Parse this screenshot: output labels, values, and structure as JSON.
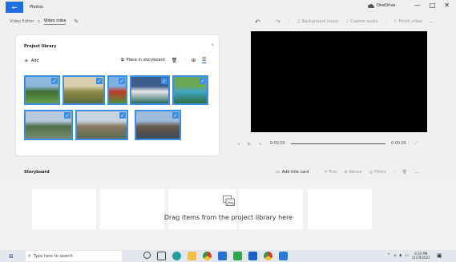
{
  "app": {
    "title": "Photos",
    "onedrive": "OneDrive"
  },
  "window_controls": {
    "minimize": "—",
    "maximize": "□",
    "close": "✕"
  },
  "breadcrumb": {
    "root": "Video Editor",
    "separator": ">",
    "current": "Video coba"
  },
  "top_toolbar": {
    "undo": "↶",
    "redo": "↷",
    "background_music": "Background music",
    "custom_audio": "Custom audio",
    "finish_video": "Finish video",
    "more": "…"
  },
  "library": {
    "title": "Project library",
    "collapse": "‹",
    "add_label": "Add",
    "place_in_storyboard": "Place in storyboard",
    "thumbnails": [
      {
        "name": "thumb-lake-tree",
        "colors": [
          "#8fb7dc",
          "#3e6e36",
          "#6aa04a"
        ]
      },
      {
        "name": "thumb-hills",
        "colors": [
          "#d9d0b0",
          "#8a8a45",
          "#5f6e3a"
        ]
      },
      {
        "name": "thumb-red-flowers",
        "colors": [
          "#7fb0e0",
          "#c03a2a",
          "#4f8f3a"
        ]
      },
      {
        "name": "thumb-mountain-lake",
        "colors": [
          "#3c5d8c",
          "#e8e8e8",
          "#2a6a5a"
        ]
      },
      {
        "name": "thumb-waterfall-pool",
        "colors": [
          "#6aa855",
          "#3fa8c8",
          "#2f7040"
        ]
      },
      {
        "name": "thumb-mountain-river",
        "colors": [
          "#b7c9de",
          "#4f6e4a",
          "#7a8e70"
        ]
      },
      {
        "name": "thumb-stone-bridge",
        "colors": [
          "#c8d4df",
          "#8a7a60",
          "#5a6a55"
        ]
      },
      {
        "name": "thumb-village",
        "colors": [
          "#9dbbdc",
          "#6a5a4a",
          "#3b4a5a"
        ]
      }
    ]
  },
  "player": {
    "current_time": "0:00.00",
    "total_time": "0:00.00",
    "fullscreen": "⤢"
  },
  "storyboard": {
    "title": "Storyboard",
    "add_title_card": "Add title card",
    "trim": "Trim",
    "resize": "Resize",
    "filters": "Filters",
    "more": "…",
    "drop_hint": "Drag items from the project library here"
  },
  "taskbar": {
    "search_placeholder": "Type here to search",
    "time": "6:33 PM",
    "date": "11/19/2021"
  },
  "colors": {
    "accent": "#1f6fe0",
    "selection": "#3d8ee6"
  }
}
